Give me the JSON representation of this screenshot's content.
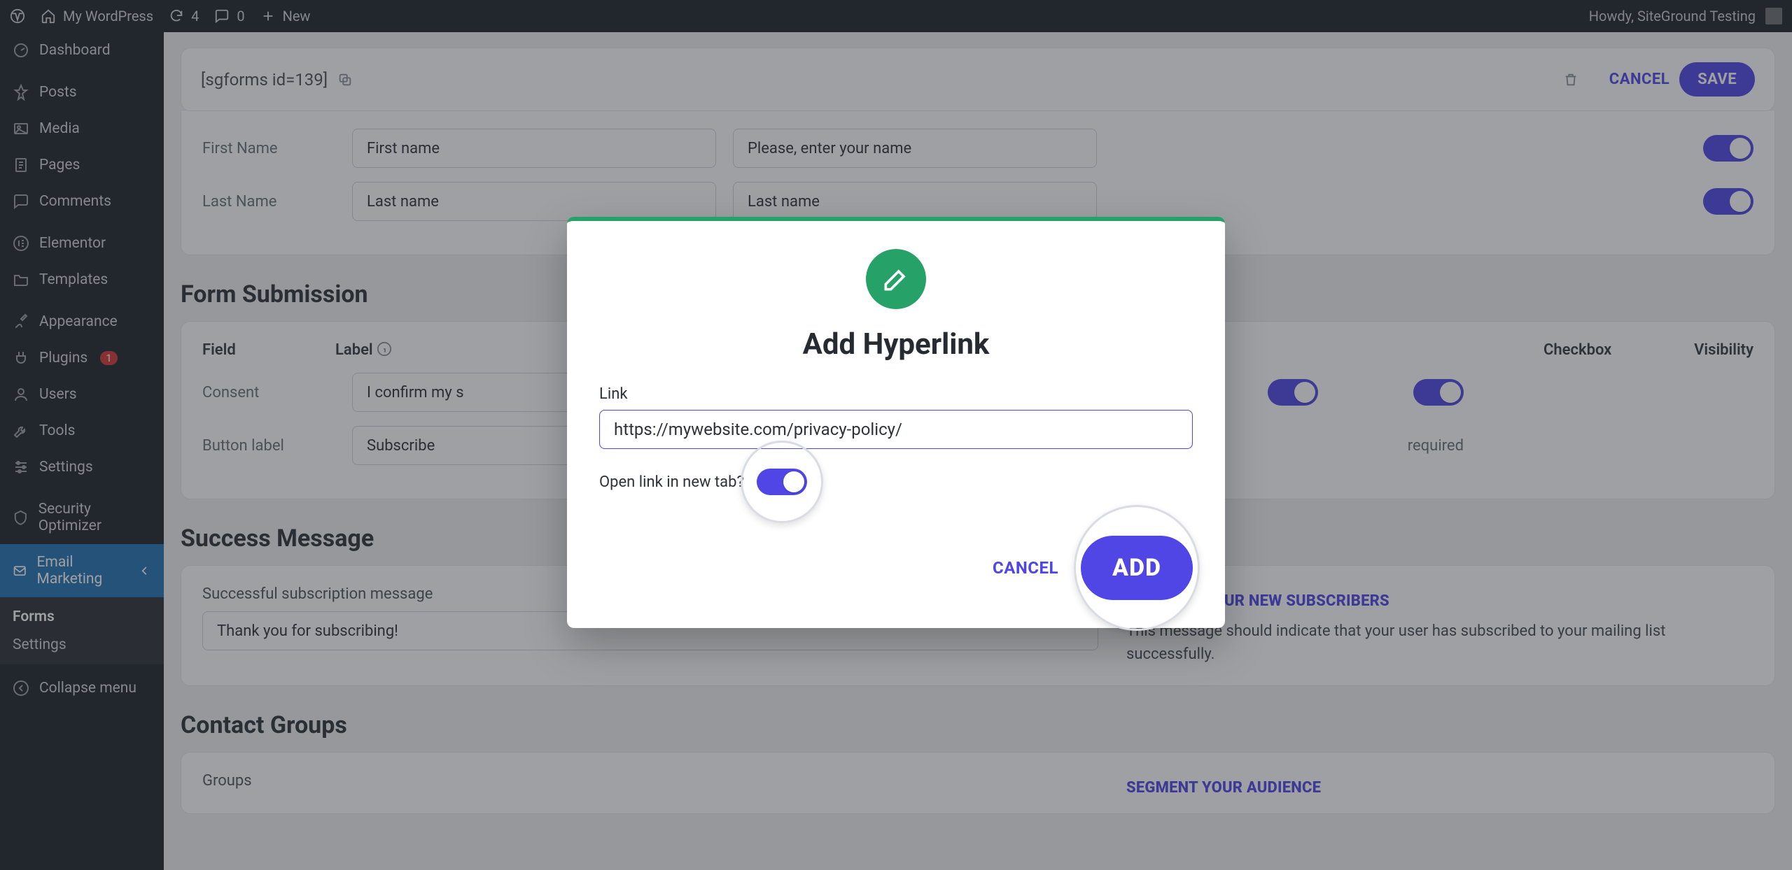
{
  "adminBar": {
    "site": "My WordPress",
    "updates": "4",
    "comments": "0",
    "new": "New",
    "greeting": "Howdy, SiteGround Testing"
  },
  "sidebar": {
    "items": [
      {
        "label": "Dashboard"
      },
      {
        "label": "Posts"
      },
      {
        "label": "Media"
      },
      {
        "label": "Pages"
      },
      {
        "label": "Comments"
      },
      {
        "label": "Elementor"
      },
      {
        "label": "Templates"
      },
      {
        "label": "Appearance"
      },
      {
        "label": "Plugins",
        "badge": "1"
      },
      {
        "label": "Users"
      },
      {
        "label": "Tools"
      },
      {
        "label": "Settings"
      },
      {
        "label": "Security Optimizer"
      },
      {
        "label": "Email Marketing"
      }
    ],
    "submenu": [
      {
        "label": "Forms",
        "current": true
      },
      {
        "label": "Settings",
        "current": false
      }
    ],
    "collapse": "Collapse menu"
  },
  "topStrip": {
    "shortcode": "[sgforms id=139]",
    "cancel": "CANCEL",
    "save": "SAVE"
  },
  "fieldsPanel": {
    "rows": [
      {
        "name": "First Name",
        "label_value": "First name",
        "placeholder_value": "Please, enter your name"
      },
      {
        "name": "Last Name",
        "label_value": "Last name",
        "placeholder_value": "Last name"
      }
    ]
  },
  "formSubmission": {
    "title": "Form Submission",
    "headers": {
      "field": "Field",
      "label": "Label",
      "checkbox": "Checkbox",
      "visibility": "Visibility"
    },
    "consent": {
      "name": "Consent",
      "value": "I confirm my s"
    },
    "button": {
      "name": "Button label",
      "value": "Subscribe",
      "visibility_note": "required"
    }
  },
  "successMessage": {
    "title": "Success Message",
    "label": "Successful subscription message",
    "value": "Thank you for subscribing!",
    "aside_h": "WELCOME YOUR NEW SUBSCRIBERS",
    "aside_p": "This message should indicate that your user has subscribed to your mailing list successfully."
  },
  "contactGroups": {
    "title": "Contact Groups",
    "label": "Groups",
    "aside_h": "SEGMENT YOUR AUDIENCE"
  },
  "modal": {
    "title": "Add Hyperlink",
    "link_label": "Link",
    "link_value": "https://mywebsite.com/privacy-policy/",
    "newtab_label": "Open link in new tab?",
    "cancel": "CANCEL",
    "add": "ADD"
  }
}
